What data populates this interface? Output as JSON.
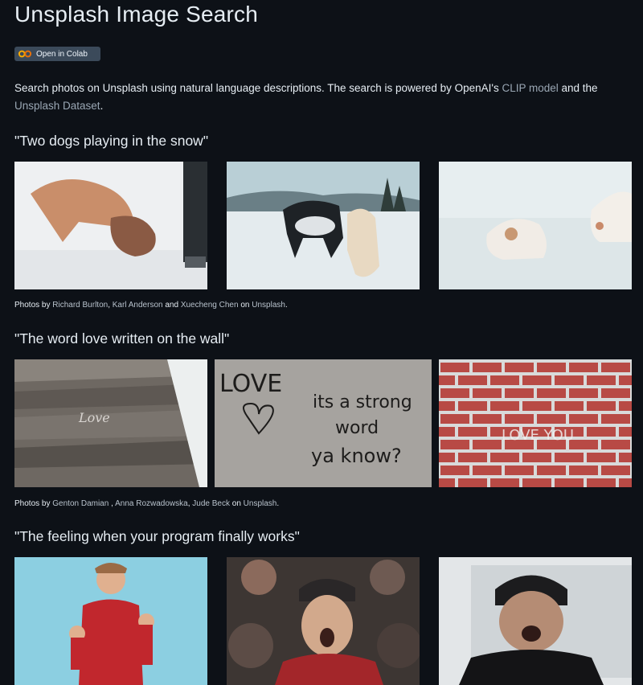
{
  "page": {
    "title": "Unsplash Image Search"
  },
  "badge": {
    "label": "Open in Colab",
    "icon": "colab-logo-icon"
  },
  "intro": {
    "text1": "Search photos on Unsplash using natural language descriptions. The search is powered by OpenAI's ",
    "link1": "CLIP model",
    "text2": " and the ",
    "link2": "Unsplash Dataset",
    "text3": "."
  },
  "sections": [
    {
      "query": "\"Two dogs playing in the snow\"",
      "photos": [
        "two-dogs-playing-snow-photo",
        "husky-and-puppy-snow-photo",
        "dogs-lying-in-snow-photo"
      ],
      "credit": {
        "prefix": "Photos by ",
        "a1": "Richard Burlton",
        "s1": ", ",
        "a2": "Karl Anderson",
        "s2": " and ",
        "a3": "Xuecheng Chen",
        "s3": " on ",
        "site": "Unsplash",
        "end": "."
      }
    },
    {
      "query": "\"The word love written on the wall\"",
      "photos": [
        "love-on-concrete-steps-photo",
        "love-graffiti-wall-photo",
        "love-on-brick-wall-photo"
      ],
      "credit": {
        "prefix": "Photos by ",
        "a1": "Genton Damian",
        "s1": " , ",
        "a2": "Anna Rozwadowska",
        "s2": ", ",
        "a3": "Jude Beck",
        "s3": " on ",
        "site": "Unsplash",
        "end": "."
      }
    },
    {
      "query": "\"The feeling when your program finally works\"",
      "photos": [
        "man-celebrating-red-sweater-photo",
        "excited-crowd-man-photo",
        "laughing-person-beanie-photo"
      ]
    }
  ],
  "graffiti": {
    "line1": "LOVE",
    "line2": "its a strong",
    "line3": "word",
    "line4": "ya know?",
    "brick": "LOVE YOU",
    "steps": "Love"
  },
  "colors": {
    "background": "#0d1117",
    "text": "#e6edf3",
    "link": "#9aa7b4",
    "badge": "#3b4a5a"
  }
}
